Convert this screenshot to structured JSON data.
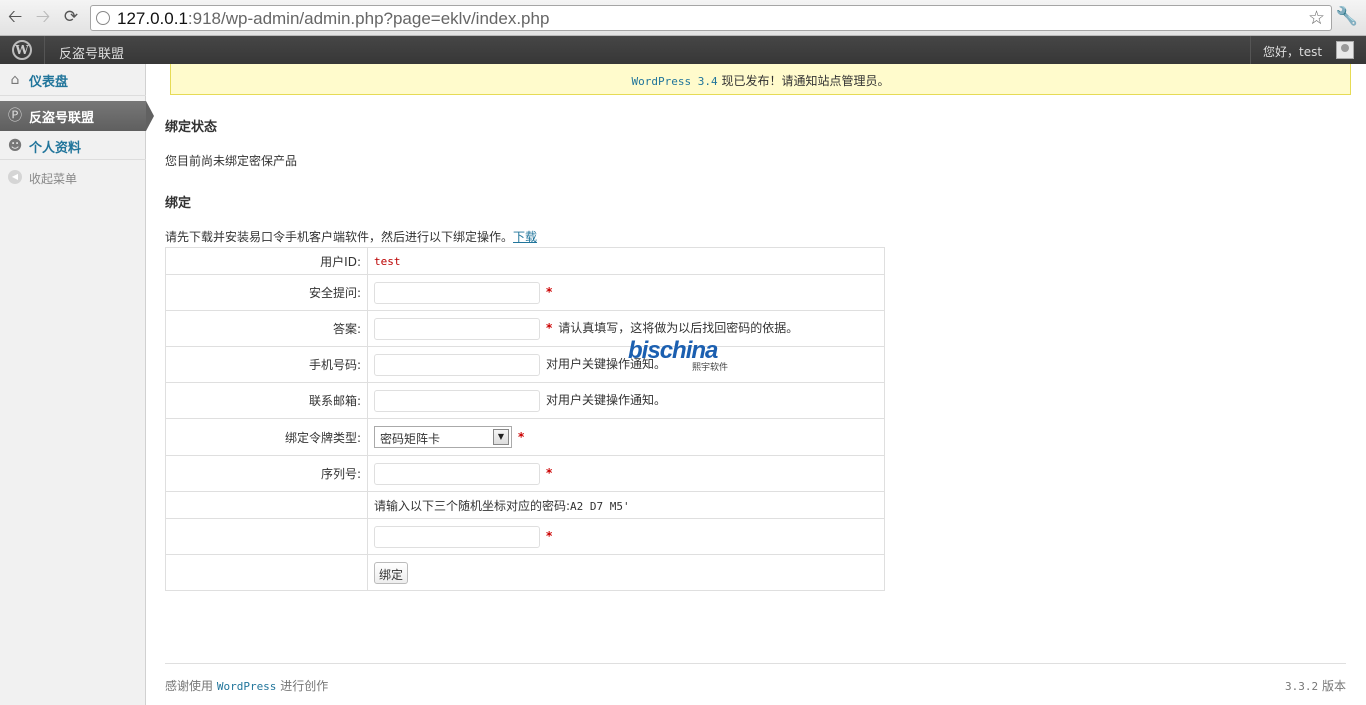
{
  "browser": {
    "url_host": "127.0.0.1",
    "url_rest": ":918/wp-admin/admin.php?page=eklv/index.php"
  },
  "adminbar": {
    "site_name": "反盗号联盟",
    "howdy": "您好，test"
  },
  "sidebar": {
    "items": [
      {
        "label": "仪表盘",
        "icon": "house-icon"
      },
      {
        "label": "反盗号联盟",
        "icon": "wordpress-icon"
      },
      {
        "label": "个人资料",
        "icon": "users-icon"
      },
      {
        "label": "收起菜单",
        "icon": "collapse-arrow-icon"
      }
    ]
  },
  "notice": {
    "link": "WordPress 3.4",
    "text": " 现已发布！请通知站点管理员。"
  },
  "content": {
    "status_heading": "绑定状态",
    "status_text": "您目前尚未绑定密保产品",
    "bind_heading": "绑定",
    "intro_text": "请先下载并安装易口令手机客户端软件，然后进行以下绑定操作。",
    "download_link": "下载"
  },
  "form": {
    "user_id_label": "用户ID:",
    "user_id_value": "test",
    "question_label": "安全提问:",
    "answer_label": "答案:",
    "answer_note": "请认真填写，这将做为以后找回密码的依据。",
    "phone_label": "手机号码:",
    "phone_note": "对用户关键操作通知。",
    "email_label": "联系邮箱:",
    "email_note": "对用户关键操作通知。",
    "token_type_label": "绑定令牌类型:",
    "token_type_value": "密码矩阵卡",
    "serial_label": "序列号:",
    "coords_prompt": "请输入以下三个随机坐标对应的密码:",
    "coords_value": "A2 D7 M5'",
    "submit_label": "绑定"
  },
  "watermark": {
    "brand_a": "bis",
    "brand_b": "china",
    "brand_sub": "熙宇软件"
  },
  "footer": {
    "thanks_prefix": "感谢使用 ",
    "thanks_link": "WordPress",
    "thanks_suffix": " 进行创作",
    "version": "3.3.2",
    "version_suffix": " 版本"
  },
  "colors": {
    "link": "#21759b",
    "notice_bg": "#fffbcc",
    "adminbar_bg": "#464646",
    "required": "#cc0000"
  }
}
